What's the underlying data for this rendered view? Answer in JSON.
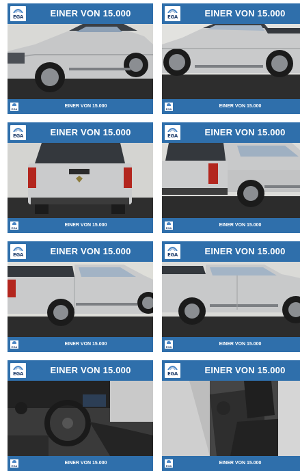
{
  "brand": {
    "logo_text": "EGA",
    "primary_color": "#2f6fab",
    "logo_text_color": "#1f3d6b"
  },
  "cards": [
    {
      "banner": "EINER VON 15.000",
      "footer": "EINER VON 15.000",
      "view": "front-left"
    },
    {
      "banner": "EINER VON 15.000",
      "footer": "EINER VON 15.000",
      "view": "side-left"
    },
    {
      "banner": "EINER VON 15.000",
      "footer": "EINER VON 15.000",
      "view": "rear"
    },
    {
      "banner": "EINER VON 15.000",
      "footer": "EINER VON 15.000",
      "view": "rear-right"
    },
    {
      "banner": "EINER VON 15.000",
      "footer": "EINER VON 15.000",
      "view": "side-right-front"
    },
    {
      "banner": "EINER VON 15.000",
      "footer": "EINER VON 15.000",
      "view": "side-right"
    },
    {
      "banner": "EINER VON 15.000",
      "footer": "EINER VON 15.000",
      "view": "interior-dashboard"
    },
    {
      "banner": "EINER VON 15.000",
      "footer": "EINER VON 15.000",
      "view": "interior-seats"
    }
  ]
}
